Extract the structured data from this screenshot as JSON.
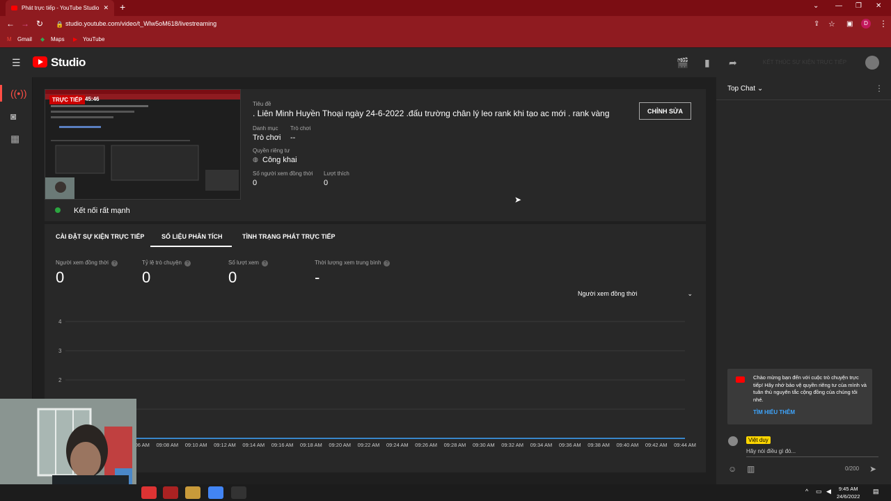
{
  "browser": {
    "tab_title": "Phát trực tiếp - YouTube Studio",
    "url": "studio.youtube.com/video/t_Wlw5oM618/livestreaming",
    "bookmarks": [
      "Gmail",
      "Maps",
      "YouTube"
    ],
    "profile_initial": "D"
  },
  "header": {
    "logo": "Studio",
    "end_stream_label": "KẾT THÚC SỰ KIỆN TRỰC TIẾP"
  },
  "stream": {
    "live_badge": "TRỰC TIẾP",
    "live_time": "45:46",
    "connection_status": "Kết nối rất mạnh",
    "title_label": "Tiêu đề",
    "title": ". Liên Minh Huyền Thoại ngày 24-6-2022 .đấu trường chân lý leo rank khi tạo ac mới . rank vàng",
    "edit_label": "CHỈNH SỬA",
    "category_label": "Danh mục",
    "category": "Trò chơi",
    "game_label": "Trò chơi",
    "game": "--",
    "privacy_label": "Quyền riêng tư",
    "privacy": "Công khai",
    "concurrent_label": "Số người xem đồng thời",
    "concurrent": "0",
    "likes_label": "Lượt thích",
    "likes": "0"
  },
  "tabs": [
    {
      "label": "CÀI ĐẶT SỰ KIỆN TRỰC TIẾP"
    },
    {
      "label": "SỐ LIỆU PHÂN TÍCH"
    },
    {
      "label": "TÌNH TRẠNG PHÁT TRỰC TIẾP"
    }
  ],
  "metrics": [
    {
      "label": "Người xem đồng thời",
      "value": "0"
    },
    {
      "label": "Tỷ lệ trò chuyện",
      "value": "0"
    },
    {
      "label": "Số lượt xem",
      "value": "0"
    },
    {
      "label": "Thời lượng xem trung bình",
      "value": "-"
    }
  ],
  "dropdown": {
    "selected": "Người xem đồng thời"
  },
  "chart_data": {
    "type": "line",
    "title": "",
    "xlabel": "",
    "ylabel": "",
    "x": [
      "09:06 AM",
      "09:08 AM",
      "09:10 AM",
      "09:12 AM",
      "09:14 AM",
      "09:16 AM",
      "09:18 AM",
      "09:20 AM",
      "09:22 AM",
      "09:24 AM",
      "09:26 AM",
      "09:28 AM",
      "09:30 AM",
      "09:32 AM",
      "09:34 AM",
      "09:36 AM",
      "09:38 AM",
      "09:40 AM",
      "09:42 AM",
      "09:44 AM"
    ],
    "series": [
      {
        "values": [
          0,
          0,
          0,
          0,
          0,
          0,
          0,
          0,
          0,
          0,
          0,
          0,
          0,
          0,
          0,
          0,
          0,
          0,
          0,
          0
        ]
      }
    ],
    "ylim": [
      0,
      4
    ],
    "yticks": [
      "4",
      "3",
      "2"
    ],
    "grid": true,
    "line_color": "#3ea6ff"
  },
  "chat": {
    "header": "Top Chat",
    "welcome_text": "Chào mừng bạn đến với cuộc trò chuyện trực tiếp! Hãy nhớ bảo vệ quyền riêng tư của mình và tuân thủ nguyên tắc cộng đồng của chúng tôi nhé.",
    "learn_more": "TÌM HIỂU THÊM",
    "username": "Việt duy",
    "input_placeholder": "Hãy nói điều gì đó...",
    "char_count": "0/200"
  },
  "taskbar": {
    "time": "9:45 AM",
    "date": "24/6/2022"
  },
  "colors": {
    "brand_red": "#ff0000",
    "accent_blue": "#3ea6ff",
    "status_green": "#2ba640"
  }
}
